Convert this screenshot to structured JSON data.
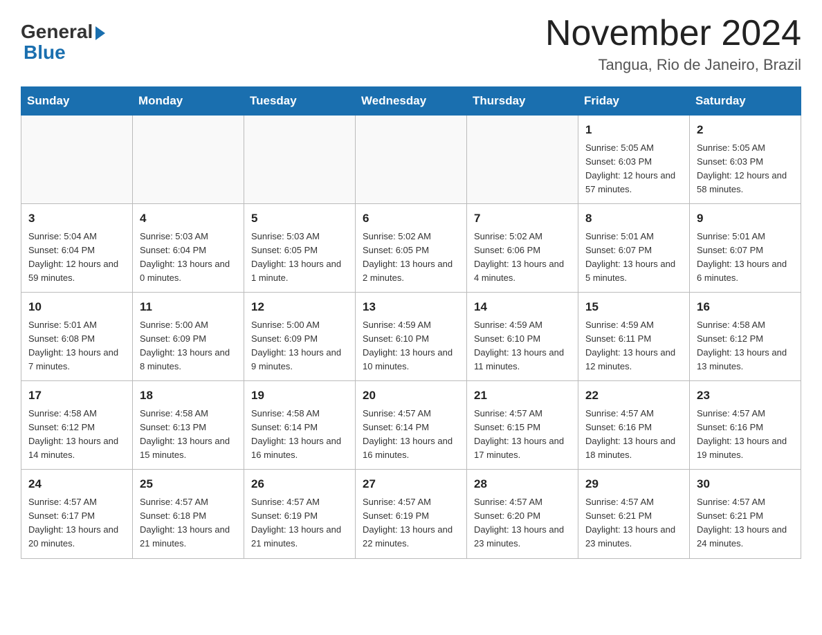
{
  "header": {
    "logo_general": "General",
    "logo_blue": "Blue",
    "month_title": "November 2024",
    "location": "Tangua, Rio de Janeiro, Brazil"
  },
  "days_of_week": [
    "Sunday",
    "Monday",
    "Tuesday",
    "Wednesday",
    "Thursday",
    "Friday",
    "Saturday"
  ],
  "weeks": [
    [
      {
        "day": "",
        "info": ""
      },
      {
        "day": "",
        "info": ""
      },
      {
        "day": "",
        "info": ""
      },
      {
        "day": "",
        "info": ""
      },
      {
        "day": "",
        "info": ""
      },
      {
        "day": "1",
        "info": "Sunrise: 5:05 AM\nSunset: 6:03 PM\nDaylight: 12 hours and 57 minutes."
      },
      {
        "day": "2",
        "info": "Sunrise: 5:05 AM\nSunset: 6:03 PM\nDaylight: 12 hours and 58 minutes."
      }
    ],
    [
      {
        "day": "3",
        "info": "Sunrise: 5:04 AM\nSunset: 6:04 PM\nDaylight: 12 hours and 59 minutes."
      },
      {
        "day": "4",
        "info": "Sunrise: 5:03 AM\nSunset: 6:04 PM\nDaylight: 13 hours and 0 minutes."
      },
      {
        "day": "5",
        "info": "Sunrise: 5:03 AM\nSunset: 6:05 PM\nDaylight: 13 hours and 1 minute."
      },
      {
        "day": "6",
        "info": "Sunrise: 5:02 AM\nSunset: 6:05 PM\nDaylight: 13 hours and 2 minutes."
      },
      {
        "day": "7",
        "info": "Sunrise: 5:02 AM\nSunset: 6:06 PM\nDaylight: 13 hours and 4 minutes."
      },
      {
        "day": "8",
        "info": "Sunrise: 5:01 AM\nSunset: 6:07 PM\nDaylight: 13 hours and 5 minutes."
      },
      {
        "day": "9",
        "info": "Sunrise: 5:01 AM\nSunset: 6:07 PM\nDaylight: 13 hours and 6 minutes."
      }
    ],
    [
      {
        "day": "10",
        "info": "Sunrise: 5:01 AM\nSunset: 6:08 PM\nDaylight: 13 hours and 7 minutes."
      },
      {
        "day": "11",
        "info": "Sunrise: 5:00 AM\nSunset: 6:09 PM\nDaylight: 13 hours and 8 minutes."
      },
      {
        "day": "12",
        "info": "Sunrise: 5:00 AM\nSunset: 6:09 PM\nDaylight: 13 hours and 9 minutes."
      },
      {
        "day": "13",
        "info": "Sunrise: 4:59 AM\nSunset: 6:10 PM\nDaylight: 13 hours and 10 minutes."
      },
      {
        "day": "14",
        "info": "Sunrise: 4:59 AM\nSunset: 6:10 PM\nDaylight: 13 hours and 11 minutes."
      },
      {
        "day": "15",
        "info": "Sunrise: 4:59 AM\nSunset: 6:11 PM\nDaylight: 13 hours and 12 minutes."
      },
      {
        "day": "16",
        "info": "Sunrise: 4:58 AM\nSunset: 6:12 PM\nDaylight: 13 hours and 13 minutes."
      }
    ],
    [
      {
        "day": "17",
        "info": "Sunrise: 4:58 AM\nSunset: 6:12 PM\nDaylight: 13 hours and 14 minutes."
      },
      {
        "day": "18",
        "info": "Sunrise: 4:58 AM\nSunset: 6:13 PM\nDaylight: 13 hours and 15 minutes."
      },
      {
        "day": "19",
        "info": "Sunrise: 4:58 AM\nSunset: 6:14 PM\nDaylight: 13 hours and 16 minutes."
      },
      {
        "day": "20",
        "info": "Sunrise: 4:57 AM\nSunset: 6:14 PM\nDaylight: 13 hours and 16 minutes."
      },
      {
        "day": "21",
        "info": "Sunrise: 4:57 AM\nSunset: 6:15 PM\nDaylight: 13 hours and 17 minutes."
      },
      {
        "day": "22",
        "info": "Sunrise: 4:57 AM\nSunset: 6:16 PM\nDaylight: 13 hours and 18 minutes."
      },
      {
        "day": "23",
        "info": "Sunrise: 4:57 AM\nSunset: 6:16 PM\nDaylight: 13 hours and 19 minutes."
      }
    ],
    [
      {
        "day": "24",
        "info": "Sunrise: 4:57 AM\nSunset: 6:17 PM\nDaylight: 13 hours and 20 minutes."
      },
      {
        "day": "25",
        "info": "Sunrise: 4:57 AM\nSunset: 6:18 PM\nDaylight: 13 hours and 21 minutes."
      },
      {
        "day": "26",
        "info": "Sunrise: 4:57 AM\nSunset: 6:19 PM\nDaylight: 13 hours and 21 minutes."
      },
      {
        "day": "27",
        "info": "Sunrise: 4:57 AM\nSunset: 6:19 PM\nDaylight: 13 hours and 22 minutes."
      },
      {
        "day": "28",
        "info": "Sunrise: 4:57 AM\nSunset: 6:20 PM\nDaylight: 13 hours and 23 minutes."
      },
      {
        "day": "29",
        "info": "Sunrise: 4:57 AM\nSunset: 6:21 PM\nDaylight: 13 hours and 23 minutes."
      },
      {
        "day": "30",
        "info": "Sunrise: 4:57 AM\nSunset: 6:21 PM\nDaylight: 13 hours and 24 minutes."
      }
    ]
  ]
}
